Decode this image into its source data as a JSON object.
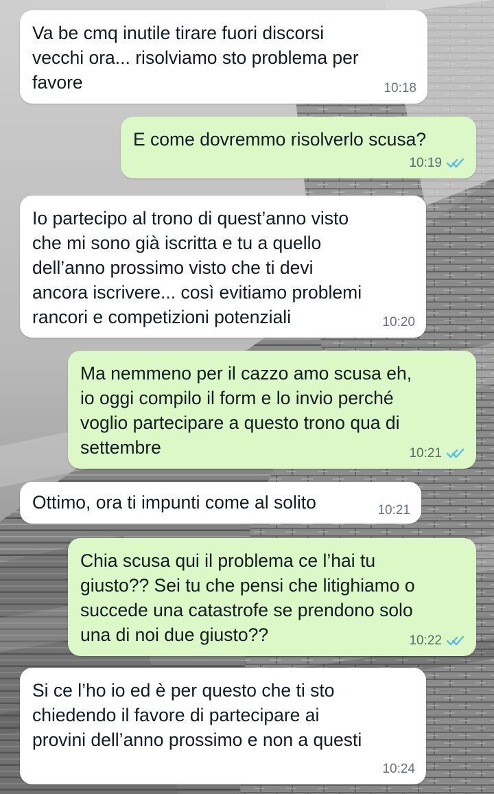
{
  "chat": {
    "wallpaper": {
      "icon": "stone-pyramid-photo",
      "style": "grayscale"
    },
    "status_colors": {
      "read_ticks": "#53bdeb",
      "outgoing_bubble": "#dcf8c6",
      "incoming_bubble": "#ffffff"
    },
    "messages": [
      {
        "direction": "incoming",
        "text": "Va be cmq inutile tirare fuori discorsi\nvecchi ora... risolviamo sto problema per\nfavore",
        "time": "10:18"
      },
      {
        "direction": "outgoing",
        "text": "E come dovremmo risolverlo scusa?",
        "time": "10:19",
        "status_icon": "double-check-read-icon"
      },
      {
        "direction": "incoming",
        "text": "Io partecipo al trono di quest’anno visto\nche mi sono già iscritta e tu a quello\ndell’anno prossimo visto che ti devi\nancora iscrivere... così evitiamo problemi\nrancori e competizioni potenziali",
        "time": "10:20"
      },
      {
        "direction": "outgoing",
        "text": "Ma nemmeno per il cazzo amo scusa eh,\nio oggi compilo il form e lo invio perché\nvoglio partecipare a questo trono qua di\nsettembre",
        "time": "10:21",
        "status_icon": "double-check-read-icon"
      },
      {
        "direction": "incoming",
        "text": "Ottimo, ora ti impunti come al solito",
        "time": "10:21"
      },
      {
        "direction": "outgoing",
        "text": "Chia scusa qui il problema ce l’hai tu\ngiusto?? Sei tu che pensi che litighiamo o\nsuccede una catastrofe se prendono solo\nuna di noi due giusto??",
        "time": "10:22",
        "status_icon": "double-check-read-icon"
      },
      {
        "direction": "incoming",
        "text": "Si ce l’ho io ed è per questo che ti sto\nchiedendo il favore di partecipare ai\nprovini dell’anno prossimo e non a questi",
        "time": "10:24"
      }
    ]
  }
}
